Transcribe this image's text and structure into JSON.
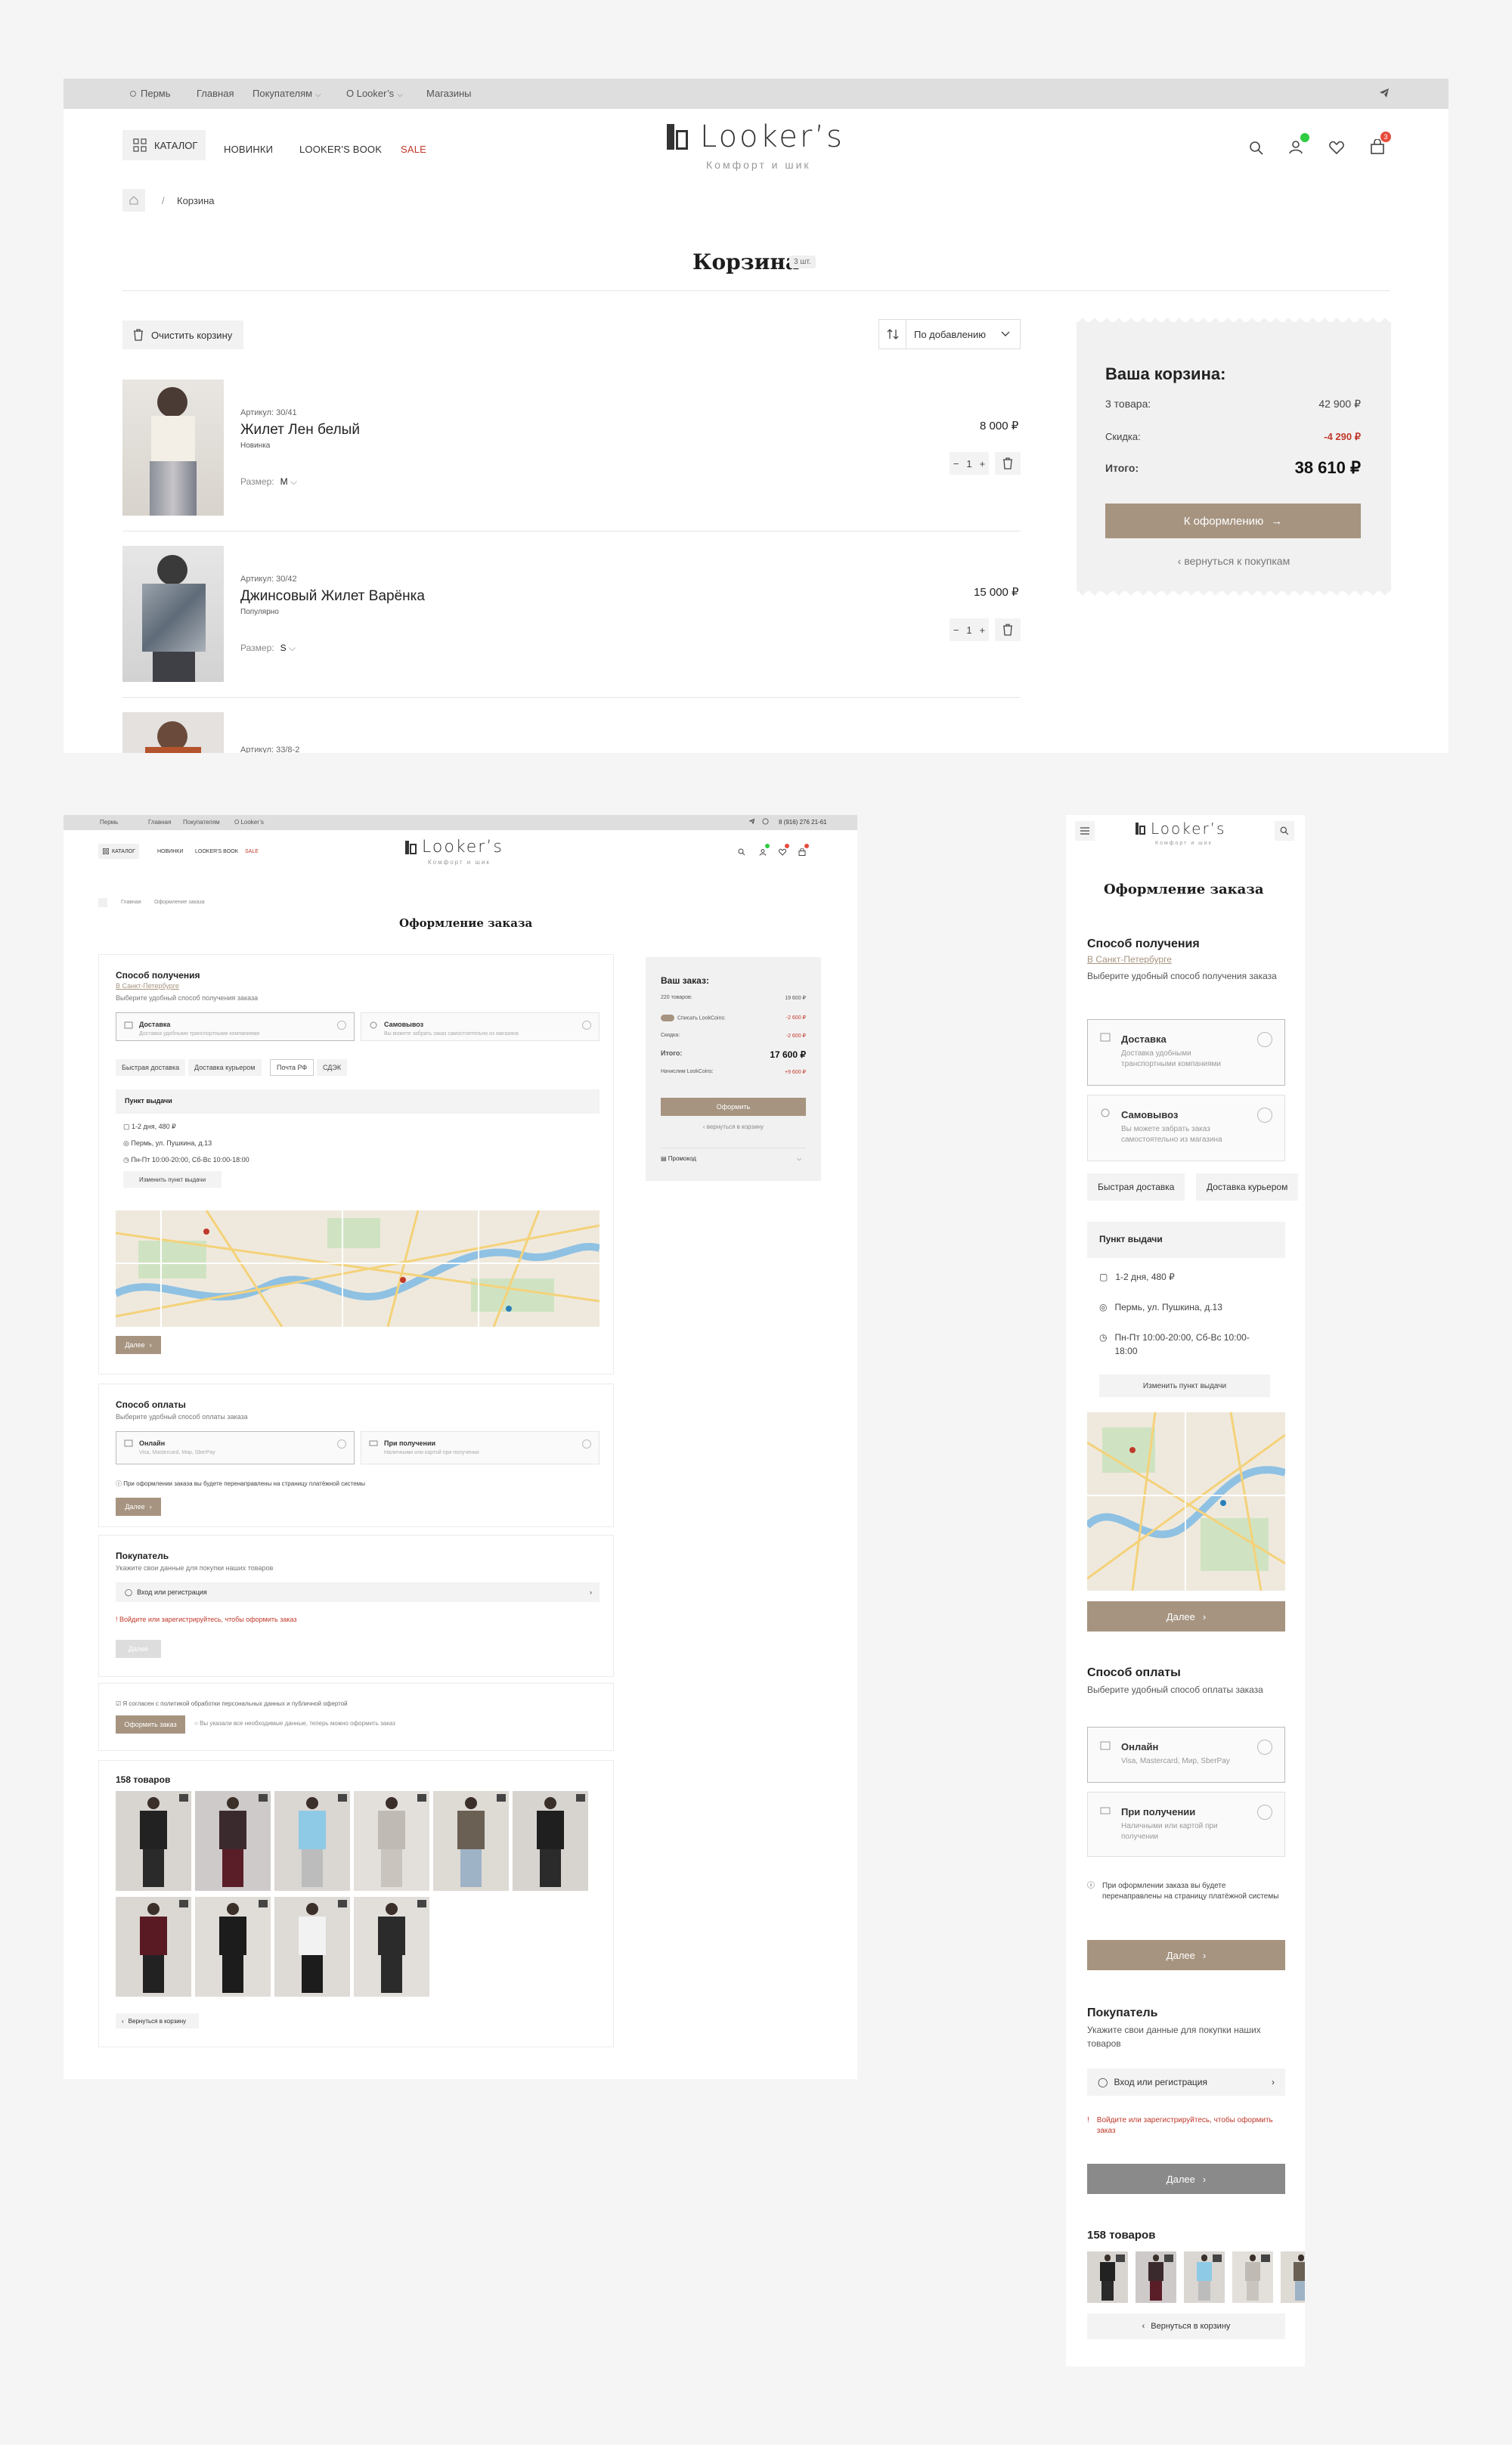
{
  "colors": {
    "accent": "#a69480",
    "discount": "#c0392b",
    "badge_green": "#2ecc40",
    "badge_red": "#e74c3c",
    "topbar": "#dedede"
  },
  "brand": {
    "name": "Looker’s",
    "tagline": "Комфорт и шик"
  },
  "topbar": {
    "city": "Пермь",
    "links": [
      "Главная",
      "Покупателям",
      "О Looker’s",
      "Магазины"
    ],
    "phone": "8 (916) 276 21-61"
  },
  "nav": {
    "catalog": "КАТАЛОГ",
    "items": [
      "НОВИНКИ",
      "LOOKER'S BOOK",
      "SALE"
    ]
  },
  "header_badges": {
    "cart_count": "3"
  },
  "cart": {
    "breadcrumb_separator": "/",
    "breadcrumb_current": "Корзина",
    "title": "Корзина",
    "count": "3 шт.",
    "clear_label": "Очистить корзину",
    "sort_label": "По добавлению",
    "size_label": "Размер:",
    "items": [
      {
        "article": "Артикул: 30/41",
        "name": "Жилет Лен белый",
        "tag": "Новинка",
        "size": "M",
        "price": "8 000 ₽",
        "qty": "1"
      },
      {
        "article": "Артикул: 30/42",
        "name": "Джинсовый Жилет Варёнка",
        "tag": "Популярно",
        "size": "S",
        "price": "15 000 ₽",
        "qty": "1"
      },
      {
        "article": "Артикул: 33/8-2",
        "name": "",
        "tag": "",
        "size": "",
        "price": "",
        "qty": ""
      }
    ],
    "summary": {
      "title": "Ваша корзина:",
      "goods_label": "3 товара:",
      "goods_value": "42 900 ₽",
      "discount_label": "Скидка:",
      "discount_value": "-4 290 ₽",
      "total_label": "Итого:",
      "total_value": "38 610 ₽",
      "checkout_label": "К оформлению",
      "back_label": "вернуться к покупкам"
    }
  },
  "checkout": {
    "breadcrumb": [
      "Главная",
      "Оформление заказа"
    ],
    "title": "Оформление заказа",
    "delivery": {
      "title": "Способ получения",
      "city": "В Санкт-Петербурге",
      "subtitle": "Выберите удобный способ получения заказа",
      "options": [
        {
          "title": "Доставка",
          "desc": "Доставка удобными транспортными компаниями"
        },
        {
          "title": "Самовывоз",
          "desc": "Вы можете забрать заказ самостоятельно из магазина"
        }
      ],
      "chips": [
        "Быстрая доставка",
        "Доставка курьером",
        "Почта РФ",
        "СДЭК"
      ],
      "pickup_title": "Пункт выдачи",
      "pickup_lines": [
        "1-2 дня, 480 ₽",
        "Пермь, ул. Пушкина, д.13",
        "Пн-Пт 10:00-20:00, Сб-Вс 10:00-18:00"
      ],
      "change_point": "Изменить пункт выдачи",
      "next": "Далее"
    },
    "payment": {
      "title": "Способ оплаты",
      "subtitle": "Выберите удобный способ оплаты заказа",
      "options": [
        {
          "title": "Онлайн",
          "desc": "Visa, Mastercard, Мир, SberPay"
        },
        {
          "title": "При получении",
          "desc": "Наличными или картой при получении"
        }
      ],
      "note": "При оформлении заказа вы будете перенаправлены на страницу платёжной системы",
      "next": "Далее"
    },
    "buyer": {
      "title": "Покупатель",
      "subtitle": "Укажите свои данные для покупки наших товаров",
      "login": "Вход или регистрация",
      "error": "Войдите или зарегистрируйтесь, чтобы оформить заказ",
      "next": "Далее"
    },
    "consent": {
      "agree": "Я согласен с политикой обработки персональных данных и публичной офертой",
      "place_order": "Оформить заказ",
      "hint": "Вы указали все необходимые данные, теперь можно оформить заказ"
    },
    "products": {
      "title": "158 товаров",
      "back": "Вернуться в корзину",
      "count": 10
    },
    "order": {
      "title": "Ваш заказ:",
      "rows": [
        {
          "label": "220 товаров:",
          "value": "19 600 ₽"
        },
        {
          "label": "Списать LookCoins:",
          "value": "-2 600 ₽"
        },
        {
          "label": "Скидка:",
          "value": "-2 600 ₽"
        },
        {
          "label": "Итого:",
          "value": "17 600 ₽"
        },
        {
          "label": "Начислим LookCoins:",
          "value": "+9 600 ₽"
        }
      ],
      "button": "Оформить",
      "back": "вернуться в корзину",
      "promo": "Промокод"
    }
  },
  "mobile": {
    "title": "Оформление заказа",
    "delivery": {
      "title": "Способ получения",
      "city": "В Санкт-Петербурге",
      "subtitle": "Выберите удобный способ получения заказа",
      "options": [
        {
          "title": "Доставка",
          "desc": "Доставка удобными транспортными компаниями"
        },
        {
          "title": "Самовывоз",
          "desc": "Вы можете забрать заказ самостоятельно из магазина"
        }
      ],
      "chips": [
        "Быстрая доставка",
        "Доставка курьером"
      ],
      "pickup_title": "Пункт выдачи",
      "pickup_lines": [
        "1-2 дня, 480 ₽",
        "Пермь, ул. Пушкина, д.13",
        "Пн-Пт 10:00-20:00, Сб-Вс 10:00-18:00"
      ],
      "change_point": "Изменить пункт выдачи",
      "next": "Далее"
    },
    "payment": {
      "title": "Способ оплаты",
      "subtitle": "Выберите удобный способ оплаты заказа",
      "options": [
        {
          "title": "Онлайн",
          "desc": "Visa, Mastercard, Мир, SberPay"
        },
        {
          "title": "При получении",
          "desc": "Наличными или картой при получении"
        }
      ],
      "note": "При оформлении заказа вы будете перенаправлены на страницу платёжной системы",
      "next": "Далее"
    },
    "buyer": {
      "title": "Покупатель",
      "subtitle": "Укажите свои данные для покупки наших товаров",
      "login": "Вход или регистрация",
      "error": "Войдите или зарегистрируйтесь, чтобы оформить заказ",
      "next": "Далее"
    },
    "products_title": "158 товаров",
    "back": "Вернуться в корзину"
  }
}
